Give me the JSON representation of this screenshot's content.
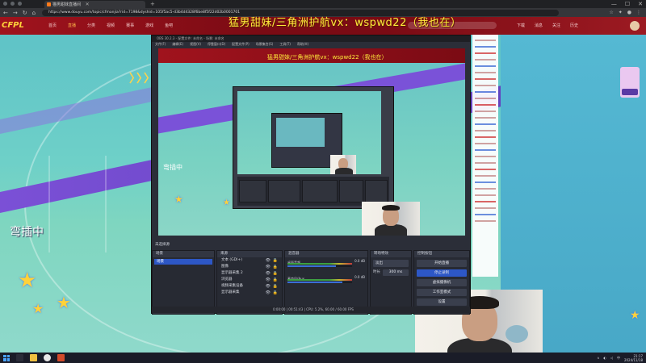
{
  "browser": {
    "tab_title": "猫男甜妹直播间",
    "url": "https://www.douyu.com/topic/cfmanjia?rid=7198&dyshid=105f5ac5-d3b4d4328f6be8f5f22d02b0001701",
    "new_tab_symbol": "+",
    "window_controls": [
      "—",
      "☐",
      "✕"
    ]
  },
  "site": {
    "logo_text": "CFPL",
    "nav_items": [
      "首页",
      "直播",
      "分类",
      "视频",
      "赛事",
      "游戏",
      "鱼吧"
    ],
    "right_links": [
      "下载",
      "消息",
      "关注",
      "历史"
    ]
  },
  "overlay": {
    "title": "猛男甜妹/三角洲护航vx：wspwd22（我也在）",
    "nested_title": "猛男甜妹/三角洲护航vx：wspwd22（我也在）"
  },
  "stream": {
    "status_text": "弯插中",
    "nested_status_text": "弯插中",
    "chevrons": "〉〉〉〉"
  },
  "obs": {
    "title": "OBS 30.2.3 - 配置文件: 未命名 - 场景: 未命名",
    "menu": [
      "文件(F)",
      "编辑(E)",
      "视图(V)",
      "停靠窗口(D)",
      "配置文件(P)",
      "场景集合(S)",
      "工具(T)",
      "帮助(H)"
    ],
    "no_source_label": "未选择源",
    "docks": {
      "scenes": {
        "title": "场景",
        "items": [
          "场景"
        ]
      },
      "sources": {
        "title": "来源",
        "items": [
          "文本 (GDI+)",
          "图像",
          "显示器采集 2",
          "浏览器",
          "视频采集设备",
          "显示器采集"
        ]
      },
      "mixer": {
        "title": "混音器",
        "channels": [
          {
            "name": "桌面音频",
            "db": "0.0 dB",
            "level": 0.75
          },
          {
            "name": "麦克风/Aux",
            "db": "0.0 dB",
            "level": 0.85
          }
        ]
      },
      "transitions": {
        "title": "转场特效",
        "type": "淡出",
        "duration_label": "时长",
        "duration": "300 ms"
      },
      "controls": {
        "title": "控制按钮",
        "buttons": [
          "开始直播",
          "停止录制",
          "虚拟摄像机",
          "工作室模式",
          "设置",
          "退出"
        ]
      }
    },
    "status": "0:00:00  |  00:51:43  |  CPU: 5.2%, 60.00 / 60.00 FPS"
  },
  "taskbar": {
    "time": "21:17",
    "date": "2024/11/18",
    "lang": "中"
  }
}
